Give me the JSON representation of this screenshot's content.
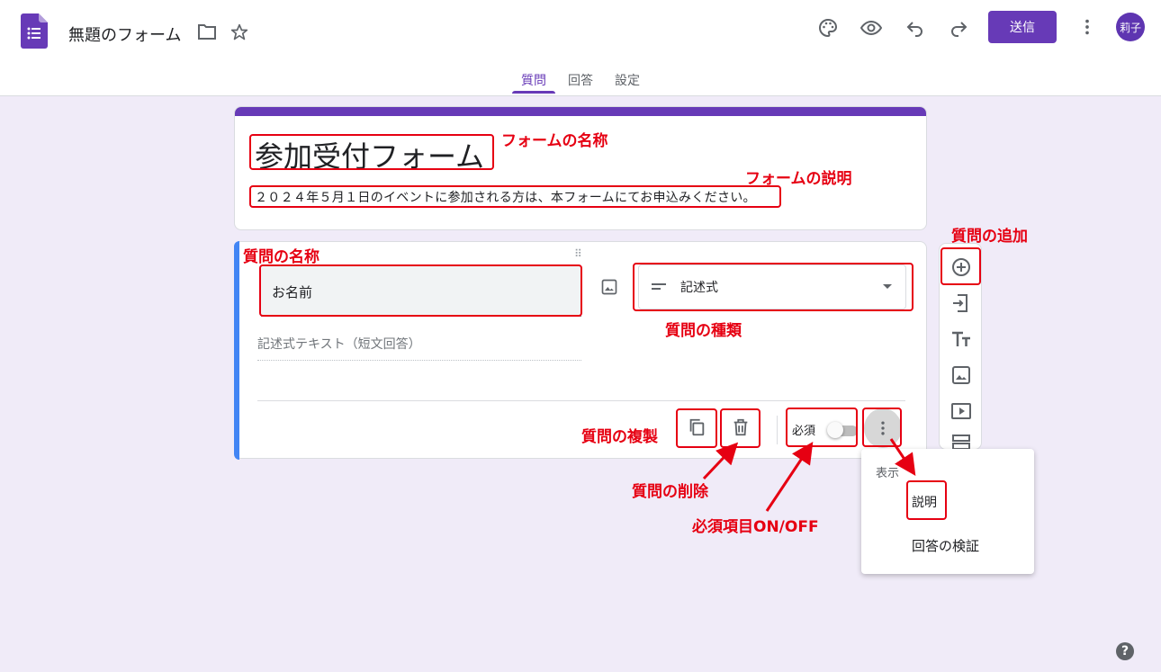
{
  "header": {
    "doc_title": "無題のフォーム",
    "send_label": "送信",
    "avatar_text": "莉子",
    "icons": [
      "forms-logo-icon",
      "folder-icon",
      "star-icon",
      "palette-icon",
      "preview-eye-icon",
      "undo-icon",
      "redo-icon",
      "more-vert-icon"
    ]
  },
  "tabs": [
    {
      "label": "質問",
      "active": true
    },
    {
      "label": "回答",
      "active": false
    },
    {
      "label": "設定",
      "active": false
    }
  ],
  "form": {
    "title": "参加受付フォーム",
    "description": "２０２４年５月１日のイベントに参加される方は、本フォームにてお申込みください。"
  },
  "question": {
    "title": "お名前",
    "type_label": "記述式",
    "answer_hint": "記述式テキスト（短文回答）",
    "required_label": "必須",
    "required_on": false,
    "drag_handle": "⠿"
  },
  "menu": {
    "header": "表示",
    "items": [
      "説明",
      "回答の検証"
    ]
  },
  "annotations": {
    "form_name": "フォームの名称",
    "form_desc": "フォームの説明",
    "question_name": "質問の名称",
    "question_type": "質問の種類",
    "add_question": "質問の追加",
    "duplicate": "質問の複製",
    "delete": "質問の削除",
    "required": "必須項目ON/OFF"
  },
  "help_label": "?",
  "colors": {
    "accent": "#673ab7",
    "annotation": "#e60012",
    "question_bar": "#4285f4",
    "background": "#f0ebf8"
  }
}
